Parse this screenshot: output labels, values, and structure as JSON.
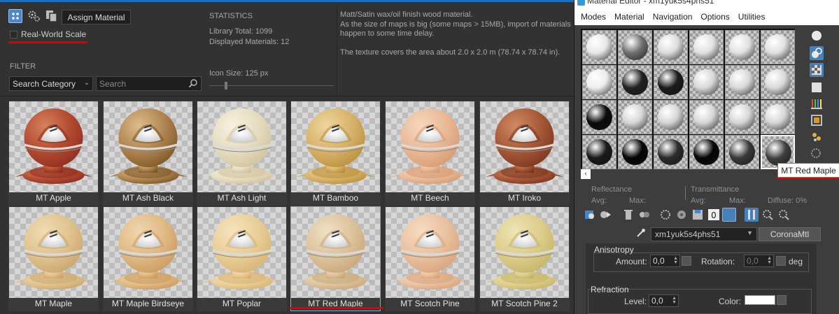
{
  "library": {
    "toolbar": {
      "assign_label": "Assign Material"
    },
    "real_world_scale": {
      "label": "Real-World Scale",
      "checked": false
    },
    "filter": {
      "label": "FILTER",
      "category_value": "Search Category",
      "search_placeholder": "Search"
    },
    "stats": {
      "title": "STATISTICS",
      "total": "Library Total: 1099",
      "displayed": "Displayed Materials: 12"
    },
    "icon_size": {
      "label": "Icon Size: 125 px"
    },
    "description": [
      "Matt/Satin wax/oil finish wood material.",
      "As the size of maps is big (some maps > 15MB), import of materials",
      "happen to some time delay.",
      "",
      "The texture covers the area about 2.0 x 2.0 m (78.74 x 78.74 in)."
    ],
    "materials": [
      {
        "name": "MT Apple",
        "base": "#8e2d1f",
        "mid": "#b24a30",
        "light": "#d6825c"
      },
      {
        "name": "MT Ash Black",
        "base": "#7a5626",
        "mid": "#b08450",
        "light": "#ddbd8c"
      },
      {
        "name": "MT Ash Light",
        "base": "#cfc19b",
        "mid": "#e5dcc0",
        "light": "#f7f1df"
      },
      {
        "name": "MT Bamboo",
        "base": "#b98f3a",
        "mid": "#d7b26a",
        "light": "#eed69e"
      },
      {
        "name": "MT Beech",
        "base": "#d49a72",
        "mid": "#e8b995",
        "light": "#f6d8bf"
      },
      {
        "name": "MT Iroko",
        "base": "#7a351f",
        "mid": "#a65836",
        "light": "#d08a63"
      },
      {
        "name": "MT Maple",
        "base": "#c9a56c",
        "mid": "#e0c28e",
        "light": "#f1dcb4"
      },
      {
        "name": "MT Maple Birdseye",
        "base": "#c99a5d",
        "mid": "#e0b985",
        "light": "#f0d6ae"
      },
      {
        "name": "MT Poplar",
        "base": "#d6b272",
        "mid": "#e9cd97",
        "light": "#f7e4bd"
      },
      {
        "name": "MT Red Maple",
        "base": "#c7a677",
        "mid": "#dcc39c",
        "light": "#efe0c5"
      },
      {
        "name": "MT Scotch Pine",
        "base": "#d7a27a",
        "mid": "#e9c19f",
        "light": "#f6dcc4"
      },
      {
        "name": "MT Scotch Pine 2",
        "base": "#c5b364",
        "mid": "#dccd8b",
        "light": "#efe4b6"
      }
    ],
    "selected_material": "MT Red Maple"
  },
  "editor": {
    "title": "Material Editor - xm1yuk5s4phs51",
    "menu": [
      "Modes",
      "Material",
      "Navigation",
      "Options",
      "Utilities"
    ],
    "slots": [
      "#e8e8e8",
      "#6f6f6f",
      "#dcdcdc",
      "#e0e0e0",
      "#e0e0e0",
      "#e0e0e0",
      "#ededed",
      "#222222",
      "#1c1c1c",
      "#d8d8d8",
      "#d8d8d8",
      "#d8d8d8",
      "#0a0a0a",
      "#d6d6d6",
      "#d6d6d6",
      "#d6d6d6",
      "#d6d6d6",
      "#d6d6d6",
      "#1a1a1a",
      "#050505",
      "#2c2c2c",
      "#050505",
      "#3a3a3a",
      "#3f3f3f"
    ],
    "active_slot_index": 23,
    "tooltip": "MT Red Maple",
    "reflectance": {
      "title": "Reflectance",
      "avg": "Avg:",
      "max": "Max:"
    },
    "transmittance": {
      "title": "Transmittance",
      "avg": "Avg:",
      "max": "Max:",
      "diffuse": "Diffuse:  0%"
    },
    "material_name": "xm1yuk5s4phs51",
    "material_type": "CoronaMtl",
    "anisotropy": {
      "title": "Anisotropy",
      "amount_label": "Amount:",
      "amount_value": "0,0",
      "rotation_label": "Rotation:",
      "rotation_value": "0,0",
      "unit": "deg"
    },
    "refraction": {
      "title": "Refraction",
      "level_label": "Level:",
      "level_value": "0,0",
      "color_label": "Color:"
    }
  }
}
